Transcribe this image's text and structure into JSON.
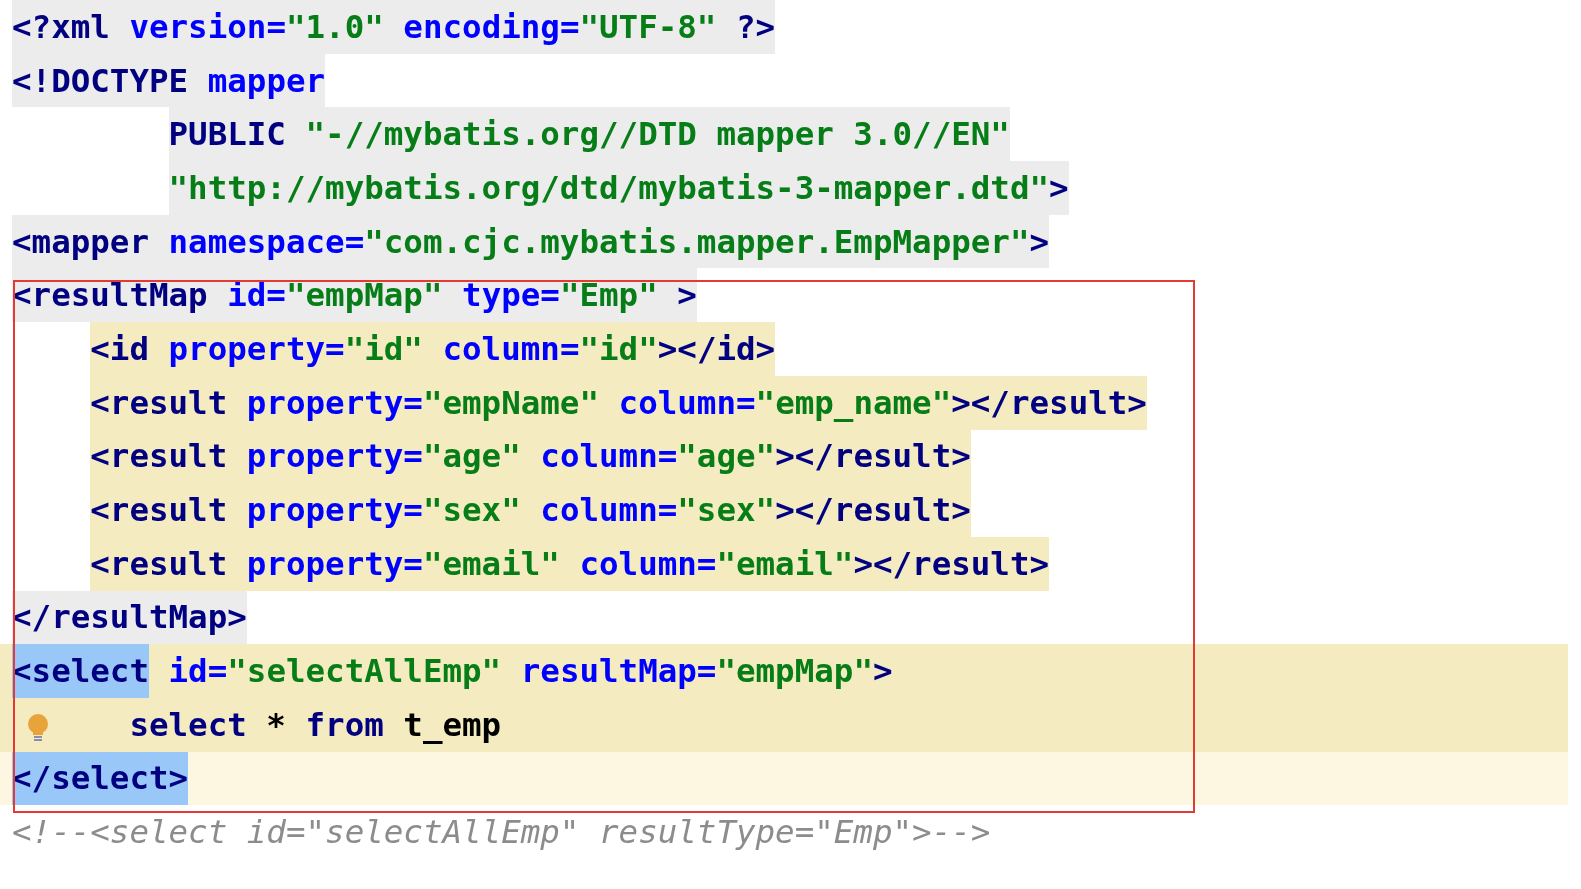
{
  "editor": {
    "lines": [
      {
        "kind": "element",
        "color": "#ececec",
        "current": false,
        "tokens": [
          {
            "kind": "tag",
            "text": "<?xml"
          },
          {
            "kind": "attr",
            "text": " version="
          },
          {
            "kind": "value",
            "text": "\"1.0\""
          },
          {
            "kind": "attr",
            "text": " encoding="
          },
          {
            "kind": "value",
            "text": "\"UTF-8\""
          },
          {
            "kind": "tag",
            "text": " ?>"
          }
        ]
      },
      {
        "kind": "element",
        "color": "#ececec",
        "current": false,
        "tokens": [
          {
            "kind": "tag",
            "text": "<!DOCTYPE"
          },
          {
            "kind": "attr",
            "text": " mapper"
          }
        ],
        "children": [
          {
            "kind": "doctype-part",
            "color": "#ececec",
            "current": false,
            "tokens": [
              {
                "kind": "tag",
                "text": "PUBLIC"
              },
              {
                "kind": "value",
                "text": " \"-//mybatis.org//DTD mapper 3.0//EN\""
              }
            ]
          },
          {
            "kind": "doctype-part",
            "color": "#ececec",
            "current": false,
            "tokens": [
              {
                "kind": "value",
                "text": "\"http://mybatis.org/dtd/mybatis-3-mapper.dtd\""
              },
              {
                "kind": "tag",
                "text": ">"
              }
            ]
          }
        ]
      },
      {
        "kind": "element",
        "color": "#ececec",
        "current": false,
        "tokens": [
          {
            "kind": "tag",
            "text": "<mapper"
          },
          {
            "kind": "attr",
            "text": " namespace="
          },
          {
            "kind": "value",
            "text": "\"com.cjc.mybatis.mapper.EmpMapper\""
          },
          {
            "kind": "tag",
            "text": ">"
          }
        ]
      },
      {
        "kind": "element",
        "color": "#ececec",
        "current": false,
        "tokens": [
          {
            "kind": "tag",
            "text": "<resultMap"
          },
          {
            "kind": "attr",
            "text": " id="
          },
          {
            "kind": "value",
            "text": "\"empMap\""
          },
          {
            "kind": "attr",
            "text": " type="
          },
          {
            "kind": "value",
            "text": "\"Emp\""
          },
          {
            "kind": "tag",
            "text": " >"
          }
        ],
        "children": [
          {
            "kind": "element",
            "color": "#f5ebc0",
            "current": false,
            "tokens": [
              {
                "kind": "tag",
                "text": "<id"
              },
              {
                "kind": "attr",
                "text": " property="
              },
              {
                "kind": "value",
                "text": "\"id\""
              },
              {
                "kind": "attr",
                "text": " column="
              },
              {
                "kind": "value",
                "text": "\"id\""
              },
              {
                "kind": "tag",
                "text": "></id>"
              }
            ]
          },
          {
            "kind": "element",
            "color": "#f5ebc0",
            "current": false,
            "tokens": [
              {
                "kind": "tag",
                "text": "<result"
              },
              {
                "kind": "attr",
                "text": " property="
              },
              {
                "kind": "value",
                "text": "\"empName\""
              },
              {
                "kind": "attr",
                "text": " column="
              },
              {
                "kind": "value",
                "text": "\"emp_name\""
              },
              {
                "kind": "tag",
                "text": "></result>"
              }
            ]
          },
          {
            "kind": "element",
            "color": "#f5ebc0",
            "current": false,
            "tokens": [
              {
                "kind": "tag",
                "text": "<result"
              },
              {
                "kind": "attr",
                "text": " property="
              },
              {
                "kind": "value",
                "text": "\"age\""
              },
              {
                "kind": "attr",
                "text": " column="
              },
              {
                "kind": "value",
                "text": "\"age\""
              },
              {
                "kind": "tag",
                "text": "></result>"
              }
            ]
          },
          {
            "kind": "element",
            "color": "#f5ebc0",
            "current": false,
            "tokens": [
              {
                "kind": "tag",
                "text": "<result"
              },
              {
                "kind": "attr",
                "text": " property="
              },
              {
                "kind": "value",
                "text": "\"sex\""
              },
              {
                "kind": "attr",
                "text": " column="
              },
              {
                "kind": "value",
                "text": "\"sex\""
              },
              {
                "kind": "tag",
                "text": "></result>"
              }
            ]
          },
          {
            "kind": "element",
            "color": "#f5ebc0",
            "current": false,
            "tokens": [
              {
                "kind": "tag",
                "text": "<result"
              },
              {
                "kind": "attr",
                "text": " property="
              },
              {
                "kind": "value",
                "text": "\"email\""
              },
              {
                "kind": "attr",
                "text": " column="
              },
              {
                "kind": "value",
                "text": "\"email\""
              },
              {
                "kind": "tag",
                "text": "></result>"
              }
            ]
          }
        ]
      },
      {
        "kind": "element",
        "color": "#ececec",
        "current": false,
        "tokens": [
          {
            "kind": "tag",
            "text": "</resultMap>"
          }
        ]
      },
      {
        "kind": "element",
        "color": "#f5ebc0",
        "current": true,
        "tokens": [
          {
            "kind": "match",
            "text": "<select"
          },
          {
            "kind": "attr",
            "text": " id="
          },
          {
            "kind": "value",
            "text": "\"selectAllEmp\""
          },
          {
            "kind": "attr",
            "text": " resultMap="
          },
          {
            "kind": "value",
            "text": "\"empMap\""
          },
          {
            "kind": "tag",
            "text": ">"
          }
        ],
        "children": [
          {
            "kind": "sql",
            "color": "#f5ebc0",
            "current": true,
            "bulb": true,
            "tokens": [
              {
                "kind": "tag",
                "text": "select"
              },
              {
                "kind": "plain",
                "text": " * "
              },
              {
                "kind": "tag",
                "text": "from"
              },
              {
                "kind": "plain",
                "text": " t_emp"
              }
            ]
          }
        ]
      },
      {
        "kind": "element",
        "color": "#fdf6e0",
        "current": true,
        "tokens": [
          {
            "kind": "match",
            "text": "</select>"
          }
        ]
      },
      {
        "kind": "element",
        "tokens": [
          {
            "kind": "comment",
            "text": "<!--<select id=\"selectAllEmp\" resultType=\"Emp\">-->"
          }
        ]
      }
    ]
  }
}
